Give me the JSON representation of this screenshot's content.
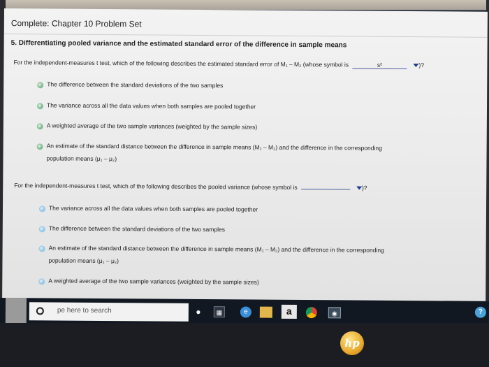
{
  "page": {
    "title": "Complete: Chapter 10 Problem Set",
    "section_heading": "5. Differentiating pooled variance and the estimated standard error of the difference in sample means"
  },
  "question1": {
    "prompt": "For the independent-measures t test, which of the following describes the estimated standard error of M₁ – M₂ (whose symbol is",
    "blank_value": "s²",
    "suffix": ")?",
    "options": [
      "The difference between the standard deviations of the two samples",
      "The variance across all the data values when both samples are pooled together",
      "A weighted average of the two sample variances (weighted by the sample sizes)",
      "An estimate of the standard distance between the difference in sample means (M₁ – M₂) and the difference in the corresponding",
      "population means (μ₁ – μ₂)"
    ]
  },
  "question2": {
    "prompt": "For the independent-measures t test, which of the following describes the pooled variance (whose symbol is",
    "blank_value": "",
    "suffix": ")?",
    "options": [
      "The variance across all the data values when both samples are pooled together",
      "The difference between the standard deviations of the two samples",
      "An estimate of the standard distance between the difference in sample means (M₁ – M₂) and the difference in the corresponding",
      "population means (μ₁ – μ₂)",
      "A weighted average of the two sample variances (weighted by the sample sizes)"
    ]
  },
  "taskbar": {
    "search_placeholder": "pe here to search",
    "icons": [
      "search-icon",
      "microphone-icon",
      "task-view-icon",
      "edge-icon",
      "file-explorer-icon",
      "amazon-icon",
      "chrome-icon",
      "camera-icon",
      "help-icon"
    ],
    "amazon_letter": "a",
    "help_glyph": "?"
  },
  "device": {
    "logo_text": "hp"
  },
  "colors": {
    "radio_green": "#6fb38a",
    "radio_blue": "#8cc3e8",
    "dropdown_accent": "#1a3a8e",
    "taskbar": "#121822"
  }
}
